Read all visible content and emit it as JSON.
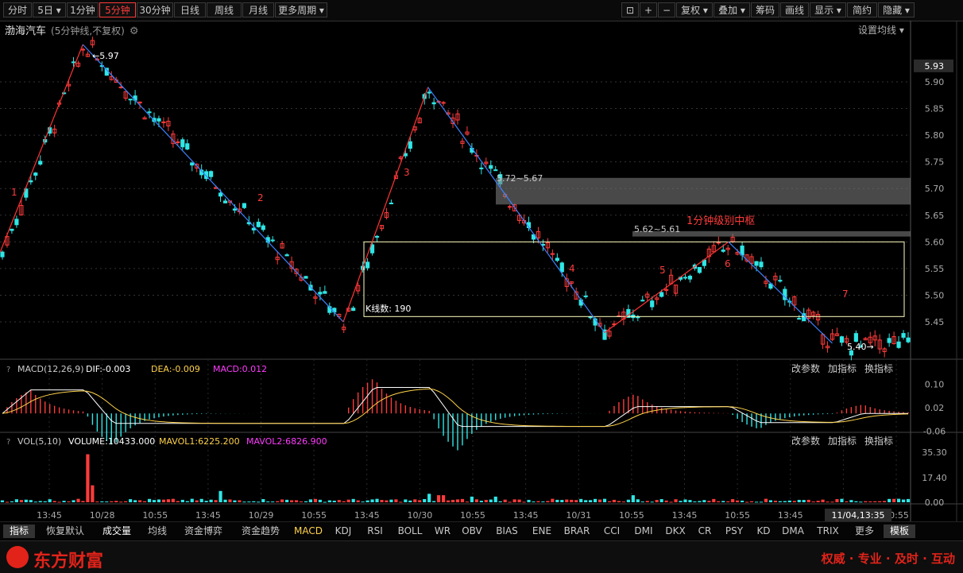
{
  "toolbar": {
    "left": [
      "分时",
      "5日 ▾",
      "1分钟",
      "5分钟",
      "30分钟",
      "日线",
      "周线",
      "月线",
      "更多周期 ▾"
    ],
    "active": "5分钟",
    "right": [
      "⊡",
      "+",
      "−",
      "复权 ▾",
      "叠加 ▾",
      "筹码",
      "画线",
      "显示 ▾",
      "简约",
      "隐藏 ▾"
    ]
  },
  "stock": {
    "name": "渤海汽车",
    "sub": "(5分钟线,不复权)",
    "settings": "设置均线 ▾"
  },
  "panels": {
    "macd": {
      "label": "MACD(12,26,9)",
      "dif": "DIF:-0.003",
      "dea": "DEA:-0.009",
      "macd": "MACD:0.012",
      "actions": [
        "改参数",
        "加指标",
        "换指标"
      ]
    },
    "vol": {
      "label": "VOL(5,10)",
      "volume": "VOLUME:10433.000",
      "mavol1": "MAVOL1:6225.200",
      "mavol2": "MAVOL2:6826.900",
      "actions": [
        "改参数",
        "加指标",
        "换指标"
      ]
    }
  },
  "bottom_tabs": [
    "指标",
    "恢复默认",
    "成交量",
    "均线",
    "资金博弈",
    "资金趋势",
    "MACD",
    "KDJ",
    "RSI",
    "BOLL",
    "WR",
    "OBV",
    "BIAS",
    "ENE",
    "BRAR",
    "CCI",
    "DMI",
    "DKX",
    "CR",
    "PSY",
    "KD",
    "DMA",
    "TRIX",
    "更多",
    "模板"
  ],
  "footer": {
    "brand": "东方财富",
    "slogan": "权威 · 专业 · 及时 · 互动"
  },
  "colors": {
    "up": "#ff3b3b",
    "down": "#2fe6e6",
    "bi_up": "#ff3333",
    "bi_down": "#3c82ff",
    "box": "#ffffbf",
    "zone": "#7a7a7a"
  },
  "chart_data": [
    {
      "type": "candlestick",
      "title": "渤海汽车",
      "ylim": [
        5.38,
        5.97
      ],
      "y_ticks": [
        5.45,
        5.5,
        5.55,
        5.6,
        5.65,
        5.7,
        5.75,
        5.8,
        5.85,
        5.9
      ],
      "last_price": "5.93",
      "x_ticks": [
        "13:45",
        "10/28",
        "10:55",
        "13:45",
        "10/29",
        "10:55",
        "13:45",
        "10/30",
        "10:55",
        "13:45",
        "10/31",
        "10:55",
        "13:45",
        "10:55",
        "13:45",
        "11/4",
        "10:55"
      ],
      "crosshair_time": "11/04,13:35",
      "annotations": {
        "high_label": "5.97",
        "low_label": "5.40",
        "k_count": "K线数: 190",
        "zone_upper_label": "5.72~5.67",
        "zone_lower_label": "5.62~5.61",
        "center_title": "1分钟级别中枢",
        "center_range": [
          5.46,
          5.6
        ],
        "segments": [
          "1",
          "2",
          "3",
          "4",
          "5",
          "6",
          "7"
        ]
      },
      "bi_points": [
        [
          0.0,
          5.58
        ],
        [
          0.091,
          5.97
        ],
        [
          0.377,
          5.45
        ],
        [
          0.47,
          5.89
        ],
        [
          0.664,
          5.43
        ],
        [
          0.8,
          5.6
        ],
        [
          0.914,
          5.41
        ]
      ]
    },
    {
      "type": "bar",
      "name": "MACD",
      "ylim": [
        -0.07,
        0.12
      ],
      "y_ticks": [
        0.1,
        0.02,
        -0.06
      ]
    },
    {
      "type": "bar",
      "name": "VOL",
      "ylim": [
        0,
        36
      ],
      "y_ticks": [
        35.3,
        17.4,
        0.0
      ]
    }
  ]
}
